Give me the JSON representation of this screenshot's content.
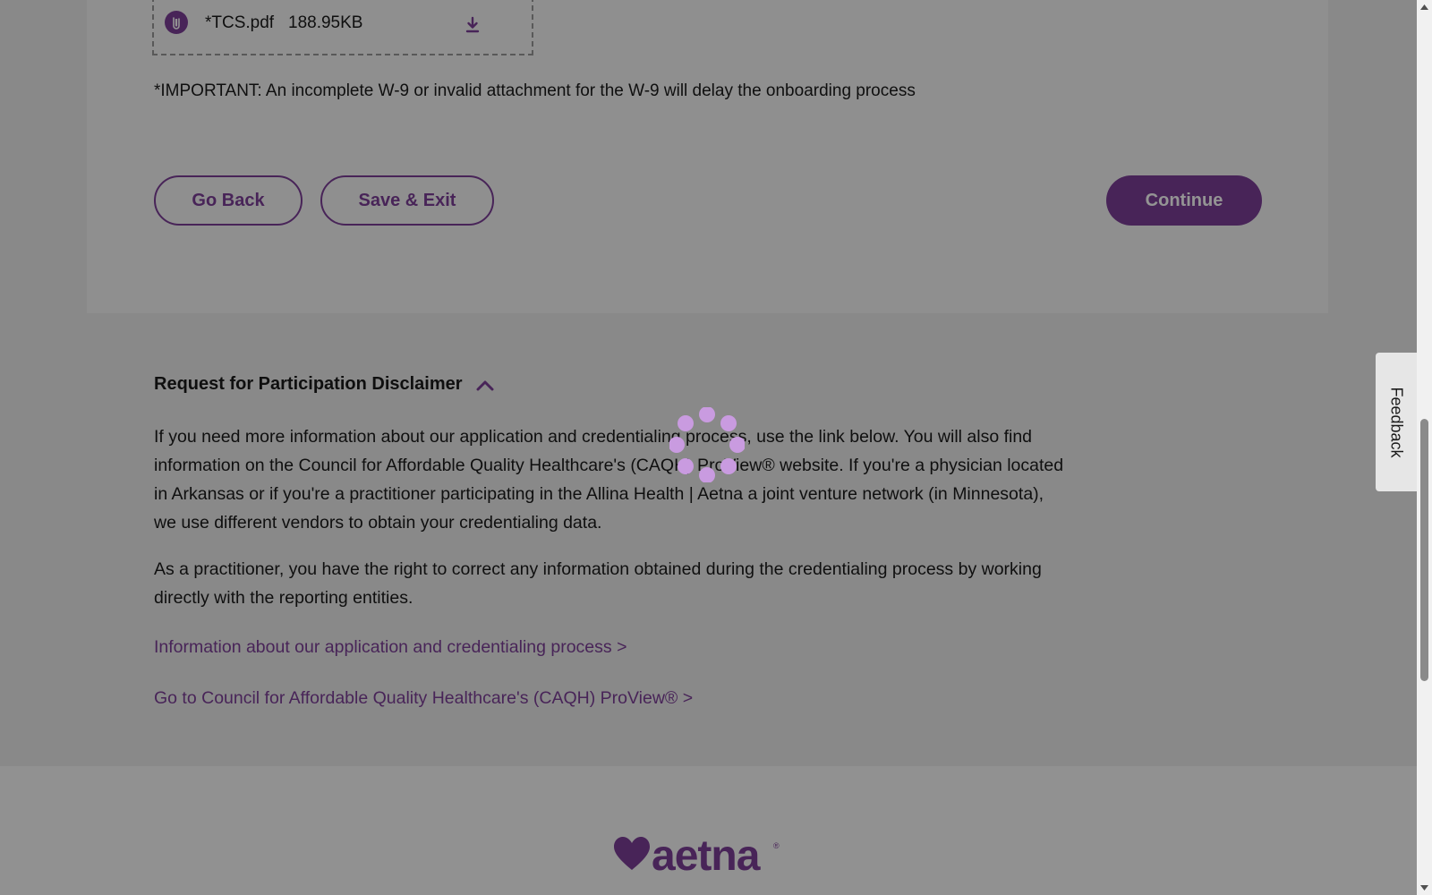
{
  "attachment": {
    "file_name": "*TCS.pdf",
    "file_size": "188.95KB",
    "icon": "paperclip-icon",
    "download_icon": "download-icon"
  },
  "important_note": "*IMPORTANT: An incomplete W-9 or invalid attachment for the W-9 will delay the onboarding process",
  "actions": {
    "go_back": "Go Back",
    "save_exit": "Save & Exit",
    "continue": "Continue"
  },
  "disclaimer": {
    "title": "Request for Participation Disclaimer",
    "toggle_icon": "chevron-up-icon",
    "paragraph_1": "If you need more information about our application and credentialing process, use the link below. You will also find information on the Council for Affordable Quality Healthcare's (CAQH) ProView® website. If you're a physician located in Arkansas or if you're a practitioner participating in the Allina Health | Aetna a joint venture network (in Minnesota), we use different vendors to obtain your credentialing data.",
    "paragraph_2": "As a practitioner, you have the right to correct any information obtained during the credentialing process by working directly with the reporting entities.",
    "link_1": "Information about our application and credentialing process >",
    "link_2": "Go to Council for Affordable Quality Healthcare's (CAQH) ProView® >"
  },
  "footer": {
    "logo_text": "aetna",
    "logo_mark": "®"
  },
  "feedback": {
    "label": "Feedback"
  },
  "loading": {
    "icon": "loading-spinner-icon"
  },
  "colors": {
    "brand": "#7d3f98",
    "overlay": "rgba(0,0,0,0.42)"
  }
}
